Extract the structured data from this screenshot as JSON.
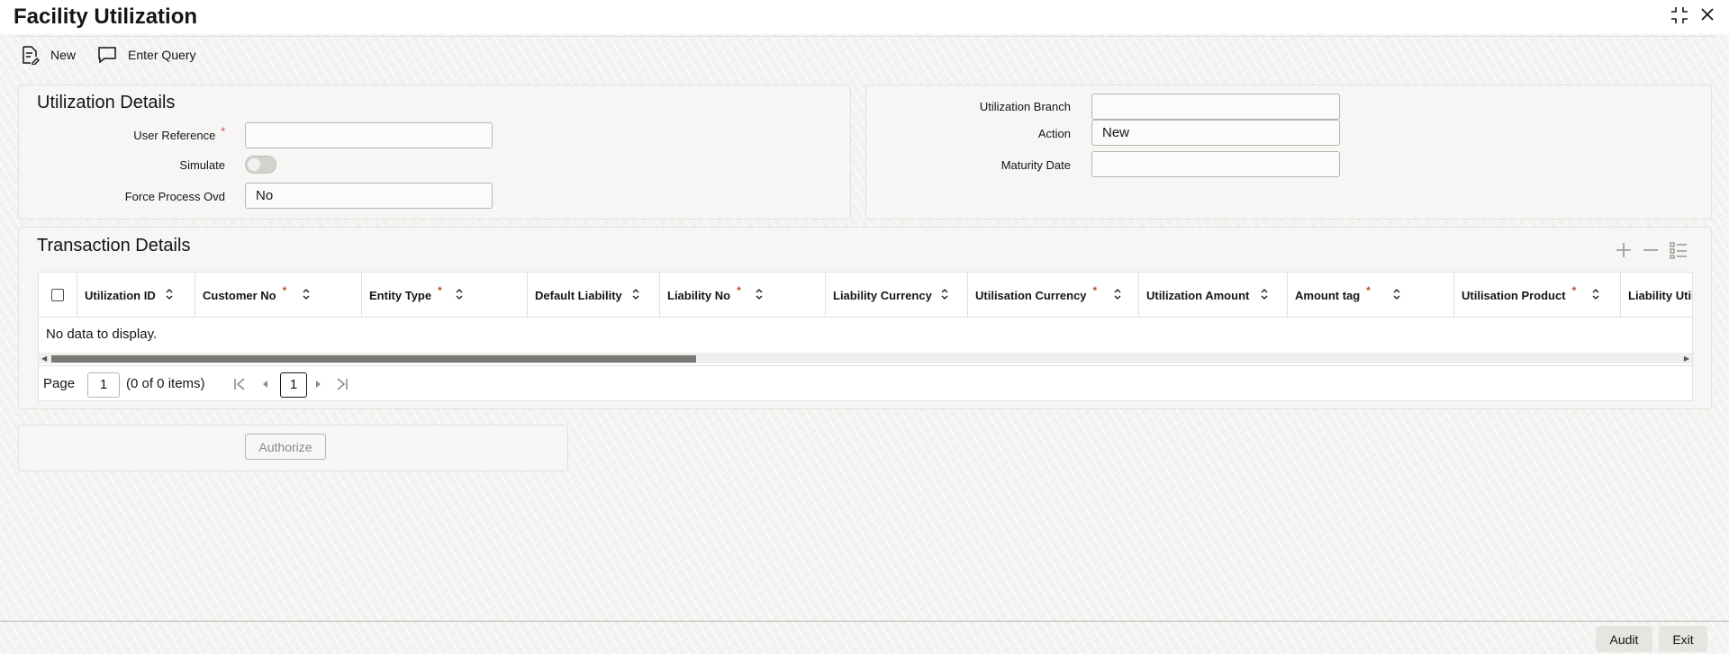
{
  "window": {
    "title": "Facility Utilization"
  },
  "toolbar": {
    "new_label": "New",
    "enter_query_label": "Enter Query"
  },
  "utilization_details": {
    "title": "Utilization Details",
    "user_reference_label": "User Reference",
    "user_reference_value": "",
    "simulate_label": "Simulate",
    "force_process_label": "Force Process Ovd",
    "force_process_value": "No"
  },
  "right_panel": {
    "branch_label": "Utilization Branch",
    "branch_value": "",
    "action_label": "Action",
    "action_value": "New",
    "maturity_label": "Maturity Date",
    "maturity_value": ""
  },
  "transaction_details": {
    "title": "Transaction Details",
    "columns": [
      {
        "label": "Utilization ID",
        "required": false
      },
      {
        "label": "Customer No",
        "required": true
      },
      {
        "label": "Entity Type",
        "required": true
      },
      {
        "label": "Default Liability",
        "required": false
      },
      {
        "label": "Liability No",
        "required": true
      },
      {
        "label": "Liability Currency",
        "required": false
      },
      {
        "label": "Utilisation Currency",
        "required": true
      },
      {
        "label": "Utilization Amount",
        "required": false
      },
      {
        "label": "Amount tag",
        "required": true
      },
      {
        "label": "Utilisation Product",
        "required": true
      },
      {
        "label": "Liability Util",
        "required": false
      }
    ],
    "required_marker": "*",
    "no_data": "No data to display.",
    "pager": {
      "page_label": "Page",
      "page_value": "1",
      "items_text": "(0 of 0 items)",
      "current_page": "1"
    }
  },
  "actions": {
    "authorize_label": "Authorize"
  },
  "footer": {
    "audit_label": "Audit",
    "exit_label": "Exit"
  }
}
